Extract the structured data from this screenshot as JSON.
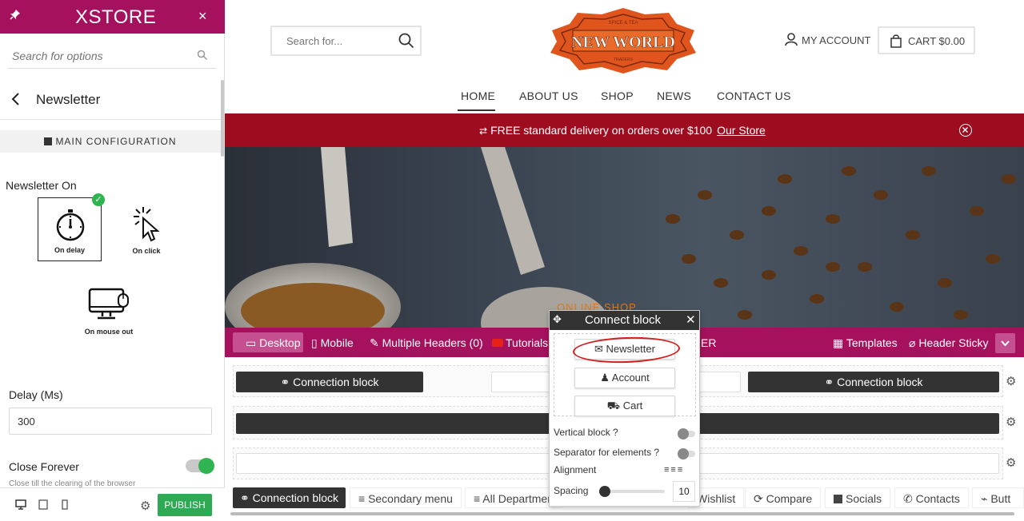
{
  "sidebar": {
    "brand": "XSTORE",
    "close": "×",
    "search_placeholder": "Search for options",
    "section_title": "Newsletter",
    "main_config": "MAIN CONFIGURATION",
    "newsletter_on_label": "Newsletter On",
    "options": [
      {
        "label": "On delay",
        "icon": "stopwatch-icon",
        "selected": true
      },
      {
        "label": "On click",
        "icon": "cursor-click-icon",
        "selected": false
      },
      {
        "label": "On mouse out",
        "icon": "monitor-mouse-icon",
        "selected": false
      }
    ],
    "delay_label": "Delay (Ms)",
    "delay_value": "300",
    "close_forever_label": "Close Forever",
    "close_forever_desc": "Close till the clearing of the browser",
    "publish": "PUBLISH"
  },
  "site": {
    "search_placeholder": "Search for...",
    "logo_text": "NEW WORLD",
    "logo_top": "SPICE & TEA",
    "logo_bottom": "TRADERS",
    "account": "MY ACCOUNT",
    "cart": "CART $0.00",
    "nav": [
      "HOME",
      "ABOUT US",
      "SHOP",
      "NEWS",
      "CONTACT US"
    ],
    "promo_text": "FREE standard delivery on orders over $100",
    "promo_link": "Our Store",
    "hero_sub": "ONLINE SHOP"
  },
  "builder": {
    "bar": [
      "Desktop",
      "Mobile",
      "Multiple Headers (0)",
      "Tutorials",
      "ER",
      "Templates",
      "Header Sticky"
    ],
    "blocks": {
      "top_left": "Connection block",
      "top_right": "Connection block"
    },
    "bottom": [
      "Connection block",
      "Secondary menu",
      "All Departmen",
      "Wishlist",
      "Compare",
      "Socials",
      "Contacts",
      "Butt"
    ]
  },
  "popup": {
    "title": "Connect block",
    "buttons": [
      "Newsletter",
      "Account",
      "Cart"
    ],
    "vertical_label": "Vertical block ?",
    "separator_label": "Separator for elements ?",
    "alignment_label": "Alignment",
    "spacing_label": "Spacing",
    "spacing_value": "10"
  },
  "colors": {
    "brand": "#a5115c",
    "promo": "#9d0d1f",
    "publish": "#2ea954",
    "accent_orange": "#e0551d"
  }
}
